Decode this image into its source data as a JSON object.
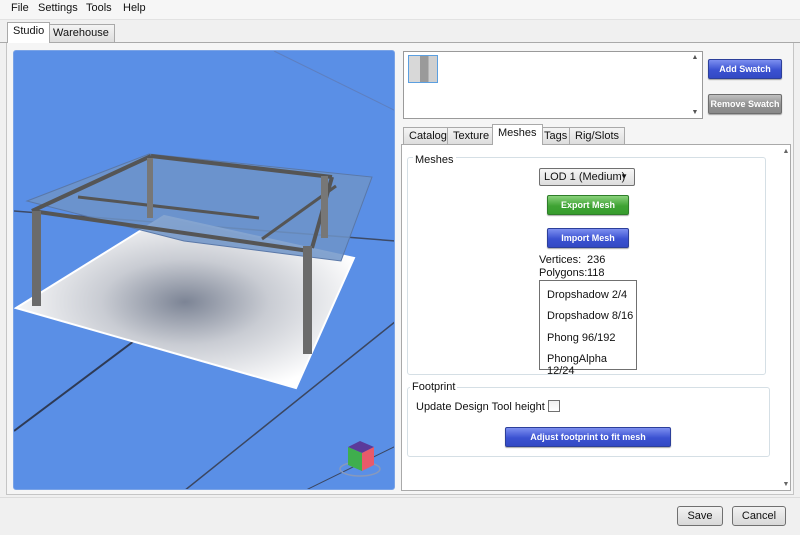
{
  "menubar": {
    "items": [
      {
        "label": "File"
      },
      {
        "label": "Settings"
      },
      {
        "label": "Tools"
      },
      {
        "label": "Help"
      }
    ]
  },
  "top_tabs": [
    {
      "label": "Studio",
      "active": true
    },
    {
      "label": "Warehouse",
      "active": false
    }
  ],
  "swatch": {
    "add_label": "Add Swatch",
    "remove_label": "Remove Swatch",
    "scroll_up": "▲",
    "scroll_down": "▼"
  },
  "sub_tabs": [
    {
      "label": "Catalog",
      "active": false
    },
    {
      "label": "Texture",
      "active": false
    },
    {
      "label": "Meshes",
      "active": true
    },
    {
      "label": "Tags",
      "active": false
    },
    {
      "label": "Rig/Slots",
      "active": false
    }
  ],
  "meshes": {
    "group_title": "Meshes",
    "lod_selected": "LOD 1 (Medium)",
    "export_label": "Export Mesh",
    "import_label": "Import Mesh",
    "vertices_label": "Vertices:",
    "vertices_value": "236",
    "polygons_label": "Polygons:",
    "polygons_value": "118",
    "list": [
      "Dropshadow 2/4",
      "Dropshadow 8/16",
      "Phong 96/192",
      "PhongAlpha 12/24"
    ]
  },
  "footprint": {
    "group_title": "Footprint",
    "update_height_label": "Update Design Tool height",
    "update_height_checked": false,
    "adjust_label": "Adjust footprint to fit mesh"
  },
  "content_scroll": {
    "up": "▲",
    "down": "▼"
  },
  "footer": {
    "save_label": "Save",
    "cancel_label": "Cancel"
  },
  "colors": {
    "viewport_bg": "#5a8fe6",
    "accent_blue": "#3b52d1",
    "accent_green": "#3fa334"
  }
}
